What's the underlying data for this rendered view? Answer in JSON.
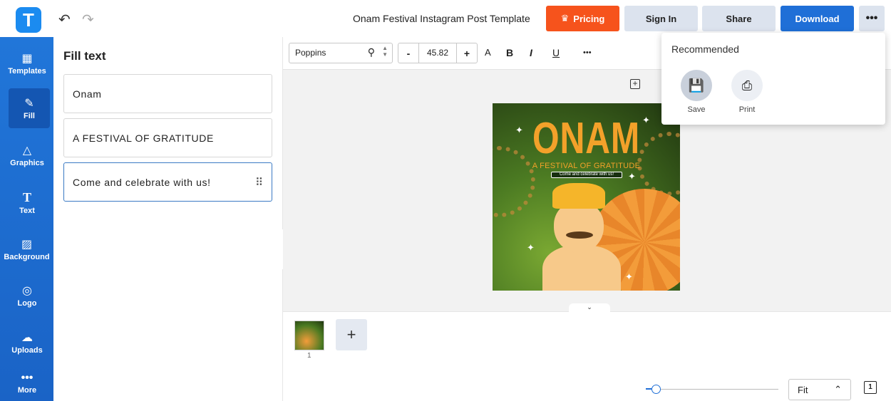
{
  "app": {
    "logo_letter": "T",
    "document_title": "Onam Festival Instagram Post Template"
  },
  "topbar": {
    "pricing": "Pricing",
    "sign_in": "Sign In",
    "share": "Share",
    "download": "Download",
    "more": "•••"
  },
  "sidebar": {
    "items": [
      {
        "label": "Templates",
        "icon": "templates-icon"
      },
      {
        "label": "Fill",
        "icon": "pencil-icon"
      },
      {
        "label": "Graphics",
        "icon": "shapes-icon"
      },
      {
        "label": "Text",
        "icon": "text-icon"
      },
      {
        "label": "Background",
        "icon": "background-icon"
      },
      {
        "label": "Logo",
        "icon": "logo-icon"
      },
      {
        "label": "Uploads",
        "icon": "cloud-upload-icon"
      },
      {
        "label": "More",
        "icon": "more-icon"
      }
    ],
    "active": "Fill"
  },
  "panel": {
    "title": "Fill text",
    "fields": [
      "Onam",
      "A FESTIVAL OF GRATITUDE",
      "Come and celebrate with us!"
    ]
  },
  "toolbar": {
    "font": "Poppins",
    "font_size": "45.82",
    "minus": "-",
    "plus": "+",
    "bold": "B",
    "italic": "I",
    "underline": "U",
    "text_color": "A",
    "more": "•••"
  },
  "poster": {
    "title": "ONAM",
    "subtitle": "A FESTIVAL OF GRATITUDE",
    "tagline": "Come and celebrate with us!"
  },
  "pages": {
    "thumb_number": "1",
    "add": "+"
  },
  "zoom": {
    "fit": "Fit",
    "page_count": "1"
  },
  "popover": {
    "title": "Recommended",
    "items": [
      {
        "label": "Save",
        "icon": "save-icon"
      },
      {
        "label": "Print",
        "icon": "print-icon"
      }
    ]
  },
  "colors": {
    "pricing": "#f6531c",
    "download": "#1f6fd7",
    "sidebar": "#2176d9",
    "poster_title": "#f3a12a"
  }
}
